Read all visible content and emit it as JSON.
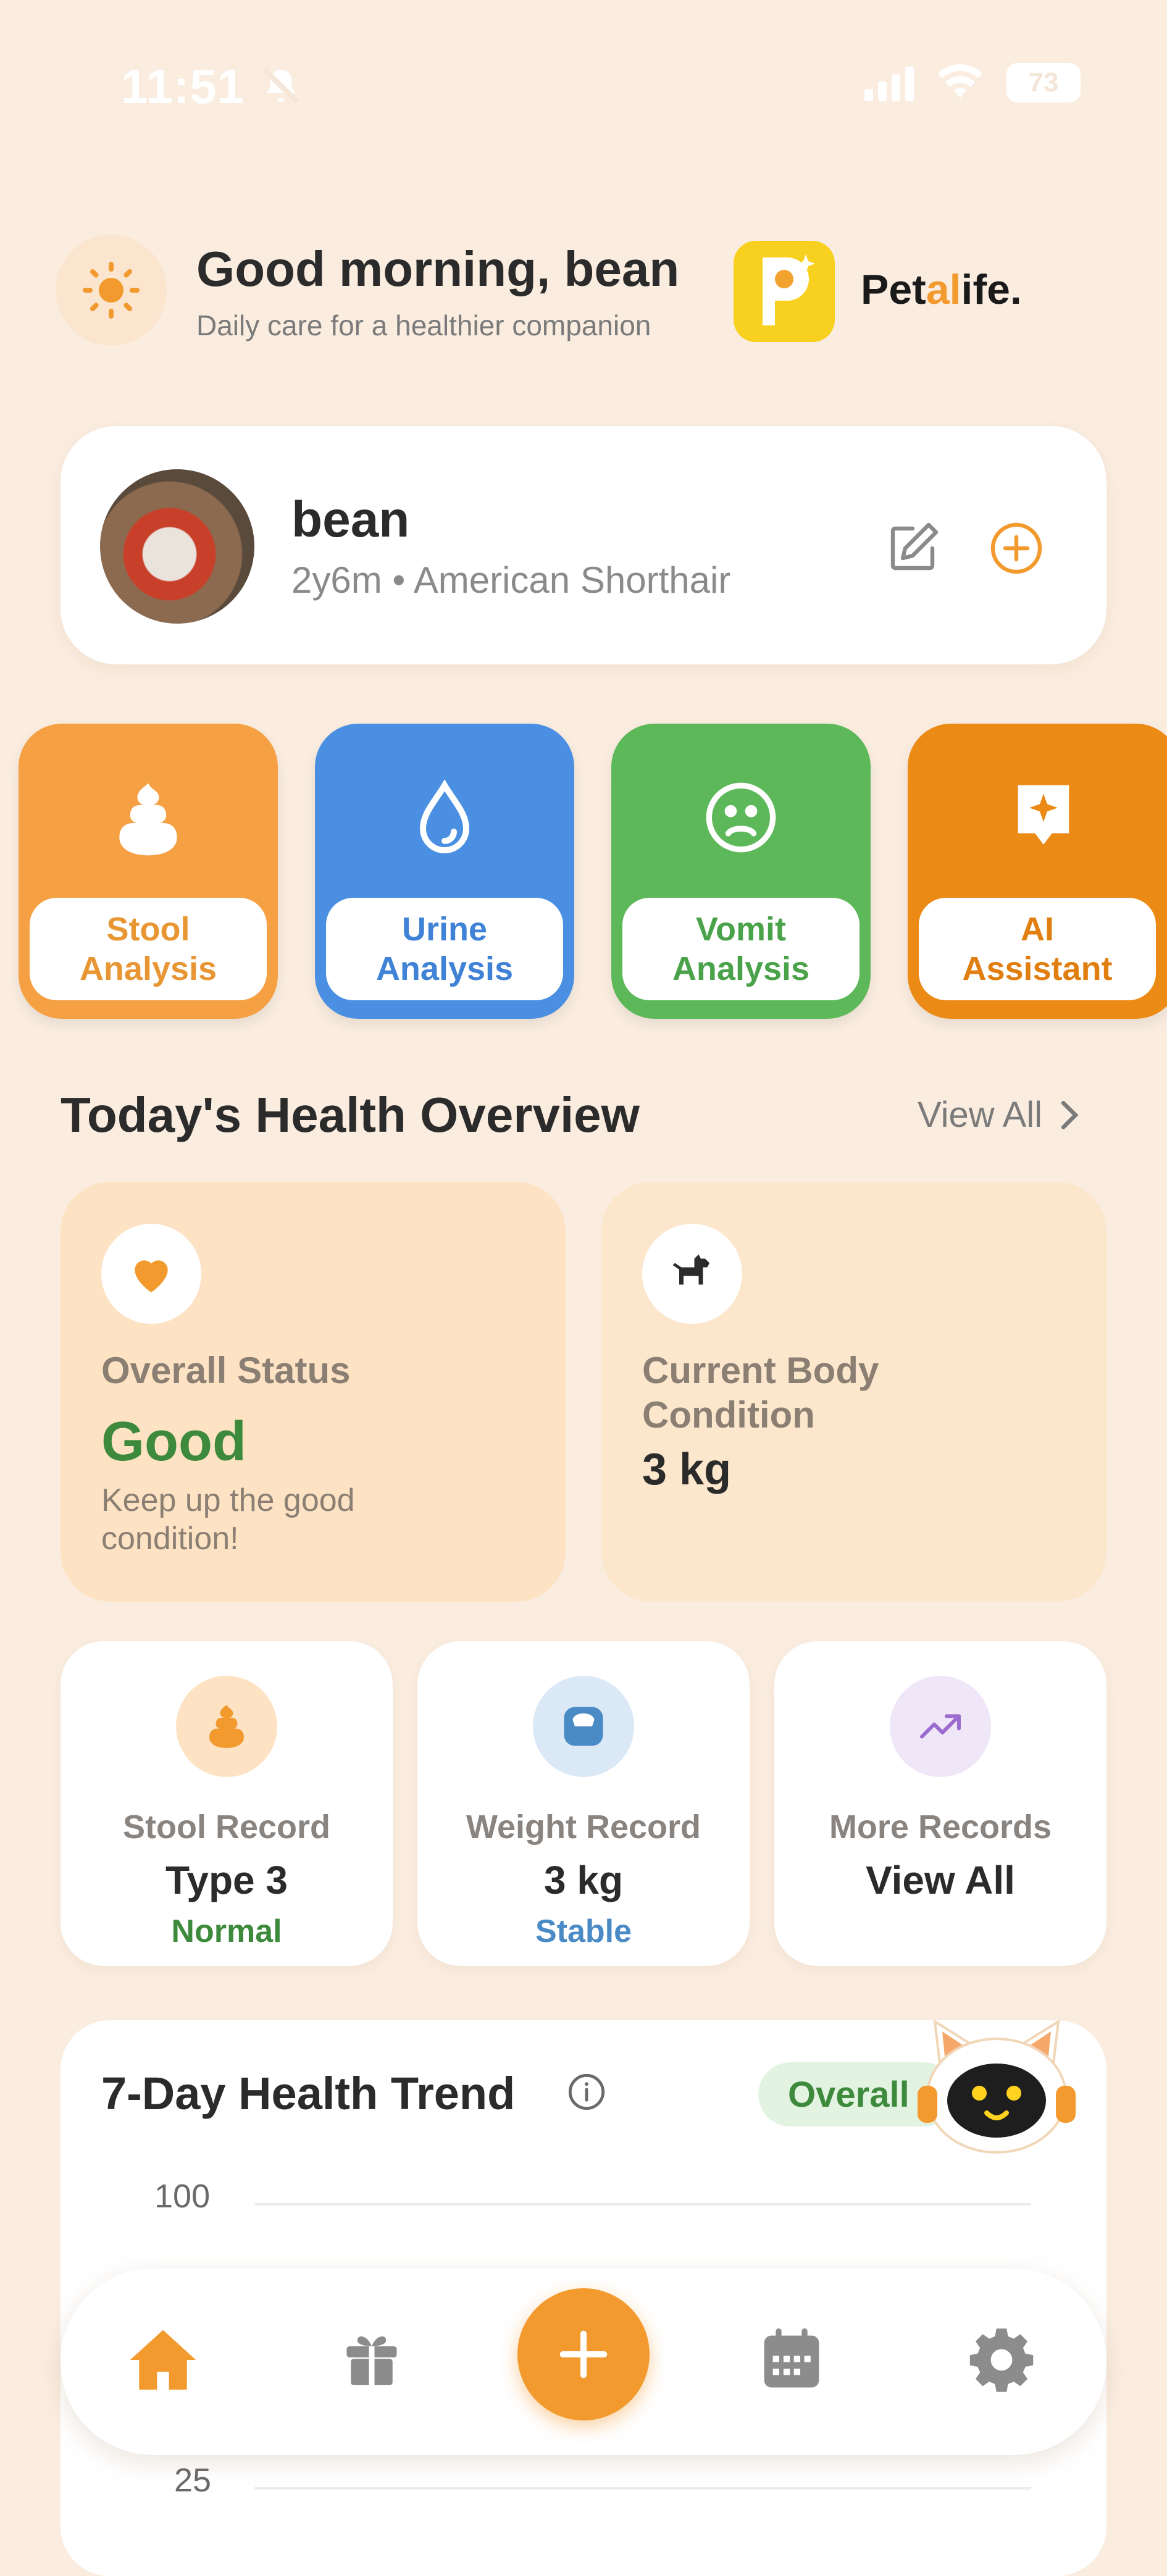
{
  "status_bar": {
    "time": "11:51",
    "battery": "73"
  },
  "header": {
    "greeting": "Good morning, bean",
    "subtitle": "Daily care for a healthier companion",
    "brand_pre": "Pet",
    "brand_accent": "al",
    "brand_post": "ife."
  },
  "pet": {
    "name": "bean",
    "info": "2y6m • American Shorthair"
  },
  "quick_actions": [
    {
      "line1": "Stool",
      "line2": "Analysis",
      "color": "#f5a043",
      "text_color": "#e89633",
      "icon": "poop-icon"
    },
    {
      "line1": "Urine",
      "line2": "Analysis",
      "color": "#4a8fe2",
      "text_color": "#3f82d6",
      "icon": "droplet-icon"
    },
    {
      "line1": "Vomit",
      "line2": "Analysis",
      "color": "#5db85a",
      "text_color": "#4aa34a",
      "icon": "sad-face-icon"
    },
    {
      "line1": "AI",
      "line2": "Assistant",
      "color": "#ec8a16",
      "text_color": "#e07f10",
      "icon": "sparkle-chat-icon"
    }
  ],
  "overview": {
    "title": "Today's Health Overview",
    "view_all": "View All",
    "status_label": "Overall Status",
    "status_value": "Good",
    "status_desc": "Keep up the good condition!",
    "body_label": "Current Body Condition",
    "body_value": "3 kg"
  },
  "records": [
    {
      "label": "Stool Record",
      "value": "Type 3",
      "sub": "Normal",
      "sub_color": "#3e8a3c",
      "icon": "poop-icon"
    },
    {
      "label": "Weight Record",
      "value": "3 kg",
      "sub": "Stable",
      "sub_color": "#4a8bc6",
      "icon": "scale-icon"
    },
    {
      "label": "More Records",
      "value": "View All",
      "sub": "",
      "icon": "trend-up-icon"
    }
  ],
  "trend": {
    "title": "7-Day Health Trend",
    "badge": "Overall",
    "y_top": "100",
    "y_low": "25"
  },
  "colors": {
    "accent": "#f29a2e",
    "background": "#faede0",
    "good_green": "#3e8a3c"
  }
}
